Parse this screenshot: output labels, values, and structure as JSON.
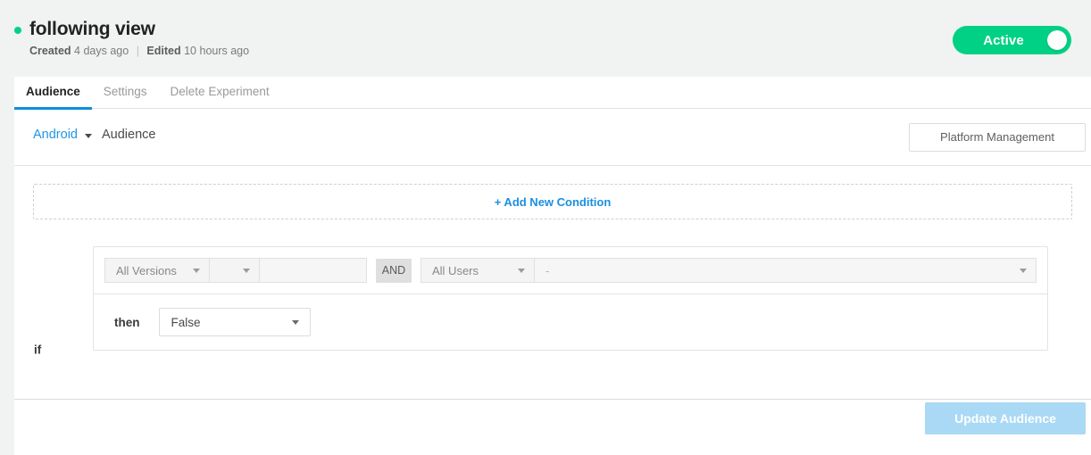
{
  "experiment": {
    "title": "following view",
    "status_dot_color": "#00d184",
    "created_label": "Created",
    "created_value": "4 days ago",
    "separator": "|",
    "edited_label": "Edited",
    "edited_value": "10 hours ago"
  },
  "toggle": {
    "label": "Active",
    "color": "#00d184"
  },
  "tabs": [
    {
      "label": "Audience",
      "active": true
    },
    {
      "label": "Settings",
      "active": false
    },
    {
      "label": "Delete Experiment",
      "active": false
    }
  ],
  "platform_row": {
    "platform": "Android",
    "section": "Audience",
    "management_button": "Platform Management"
  },
  "audience": {
    "add_condition": "+ Add New Condition",
    "if_label": "if",
    "then_label": "then",
    "and_label": "AND",
    "condition": {
      "versions": "All Versions",
      "operator": "",
      "value": "",
      "users": "All Users",
      "users_value": "-"
    },
    "then_value": "False"
  },
  "footer": {
    "update_button": "Update Audience",
    "update_button_color": "#a9d9f5"
  },
  "icons": {
    "caret_down": "chevron-down-icon",
    "status_dot": "status-dot-icon"
  }
}
